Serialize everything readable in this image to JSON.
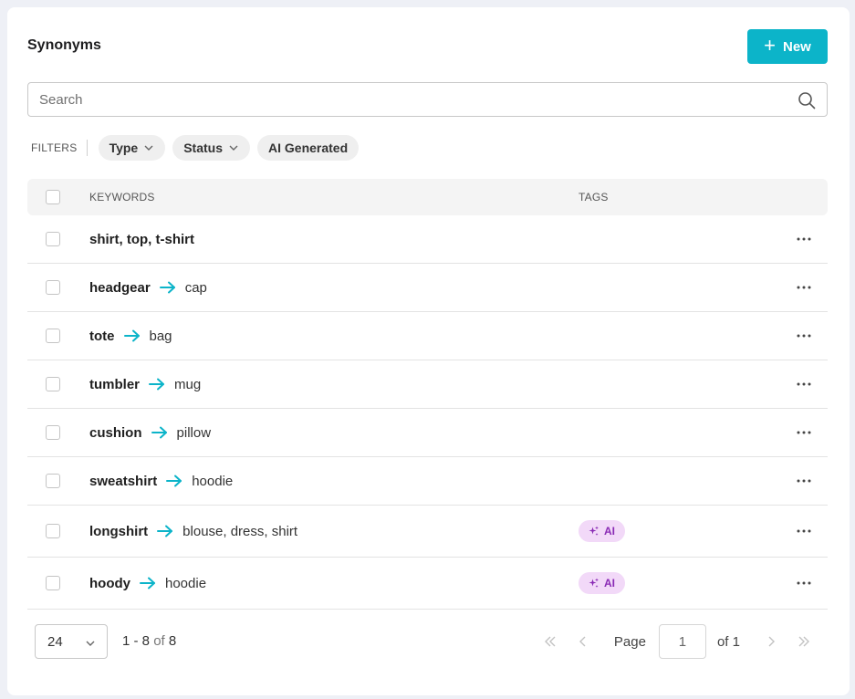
{
  "header": {
    "title": "Synonyms",
    "new_button": {
      "label": "New",
      "icon": "plus-icon"
    }
  },
  "search": {
    "placeholder": "Search",
    "value": "",
    "icon": "search-icon"
  },
  "filters": {
    "label": "FILTERS",
    "chips": [
      {
        "label": "Type",
        "has_dropdown": true
      },
      {
        "label": "Status",
        "has_dropdown": true
      },
      {
        "label": "AI Generated",
        "has_dropdown": false
      }
    ]
  },
  "table": {
    "columns": {
      "keywords": "KEYWORDS",
      "tags": "TAGS"
    },
    "rows": [
      {
        "from": "shirt, top, t-shirt",
        "to": "",
        "tag": ""
      },
      {
        "from": "headgear",
        "to": "cap",
        "tag": ""
      },
      {
        "from": "tote",
        "to": "bag",
        "tag": ""
      },
      {
        "from": "tumbler",
        "to": "mug",
        "tag": ""
      },
      {
        "from": "cushion",
        "to": "pillow",
        "tag": ""
      },
      {
        "from": "sweatshirt",
        "to": "hoodie",
        "tag": ""
      },
      {
        "from": "longshirt",
        "to": "blouse, dress, shirt",
        "tag": "AI"
      },
      {
        "from": "hoody",
        "to": "hoodie",
        "tag": "AI"
      }
    ]
  },
  "pagination": {
    "per_page": "24",
    "range_text": "1 - 8",
    "of_word": "of",
    "total": "8",
    "page_label": "Page",
    "current_page": "1",
    "of_pages": "of 1"
  },
  "colors": {
    "accent": "#0cb4c9",
    "ai_tag_bg": "#f2d9f8",
    "ai_tag_text": "#8a2bb5"
  }
}
